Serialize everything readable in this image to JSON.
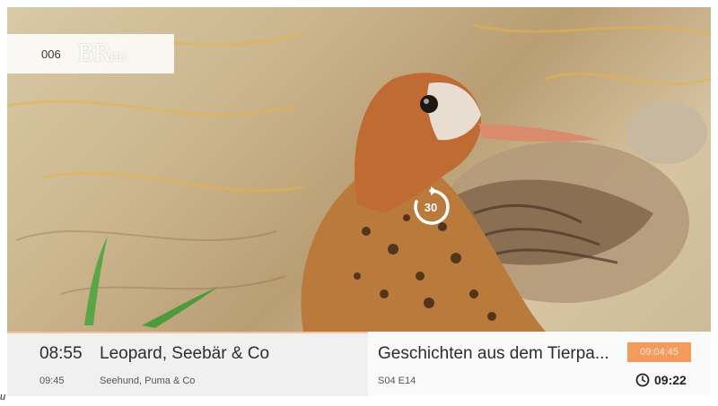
{
  "channel": {
    "number": "006",
    "logo_text": "BR",
    "logo_suffix": "HD"
  },
  "replay": {
    "seconds": "30"
  },
  "now": {
    "time": "08:55",
    "title": "Leopard, Seebär & Co"
  },
  "next": {
    "time": "09:45",
    "title": "Seehund, Puma & Co"
  },
  "selected": {
    "title": "Geschichten aus dem Tierpa...",
    "episode": "S04 E14",
    "timestamp_badge": "09:04:45",
    "end_time": "09:22"
  },
  "corner_mark": "u",
  "colors": {
    "accent": "#f39b5c",
    "bar_background": "#f0f0f0"
  },
  "icons": {
    "replay": "replay-30-icon",
    "clock": "clock-icon"
  }
}
